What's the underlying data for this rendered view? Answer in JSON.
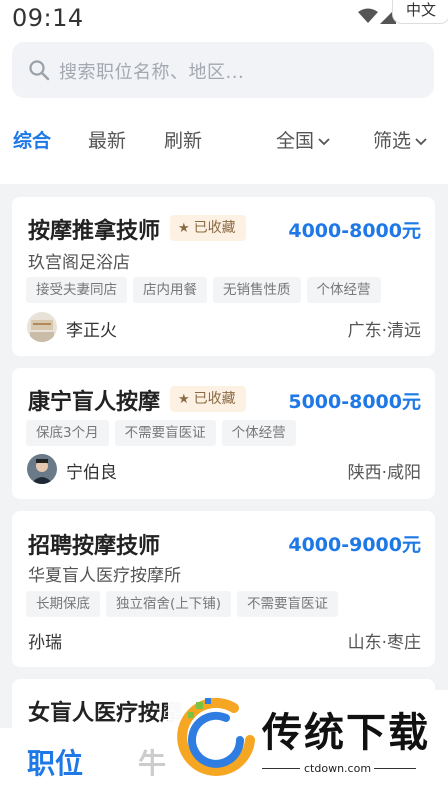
{
  "status": {
    "time": "09:14",
    "ime": "中文"
  },
  "search": {
    "placeholder": "搜索职位名称、地区..."
  },
  "tabs": {
    "all": "综合",
    "latest": "最新",
    "refresh": "刷新",
    "region": "全国",
    "filter": "筛选"
  },
  "jobs": [
    {
      "title": "按摩推拿技师",
      "favorite": "已收藏",
      "salary": "4000-8000元",
      "company": "玖宫阁足浴店",
      "tags": [
        "接受夫妻同店",
        "店内用餐",
        "无销售性质",
        "个体经营"
      ],
      "person": "李正火",
      "location": "广东·清远"
    },
    {
      "title": "康宁盲人按摩",
      "favorite": "已收藏",
      "salary": "5000-8000元",
      "tags": [
        "保底3个月",
        "不需要盲医证",
        "个体经营"
      ],
      "person": "宁伯良",
      "location": "陕西·咸阳"
    },
    {
      "title": "招聘按摩技师",
      "salary": "4000-9000元",
      "company": "华夏盲人医疗按摩所",
      "tags": [
        "长期保底",
        "独立宿舍(上下铺)",
        "不需要盲医证"
      ],
      "person": "孙瑞",
      "location": "山东·枣庄"
    },
    {
      "title": "女盲人医疗按摩"
    }
  ],
  "bottom_nav": {
    "jobs": "职位",
    "partial": "牛"
  },
  "watermark": {
    "text": "传统下载",
    "url": "ctdown.com"
  },
  "colors": {
    "accent": "#1e78e6",
    "favorite_bg": "#fdf1e4",
    "tag_bg": "#f3f4f6"
  }
}
